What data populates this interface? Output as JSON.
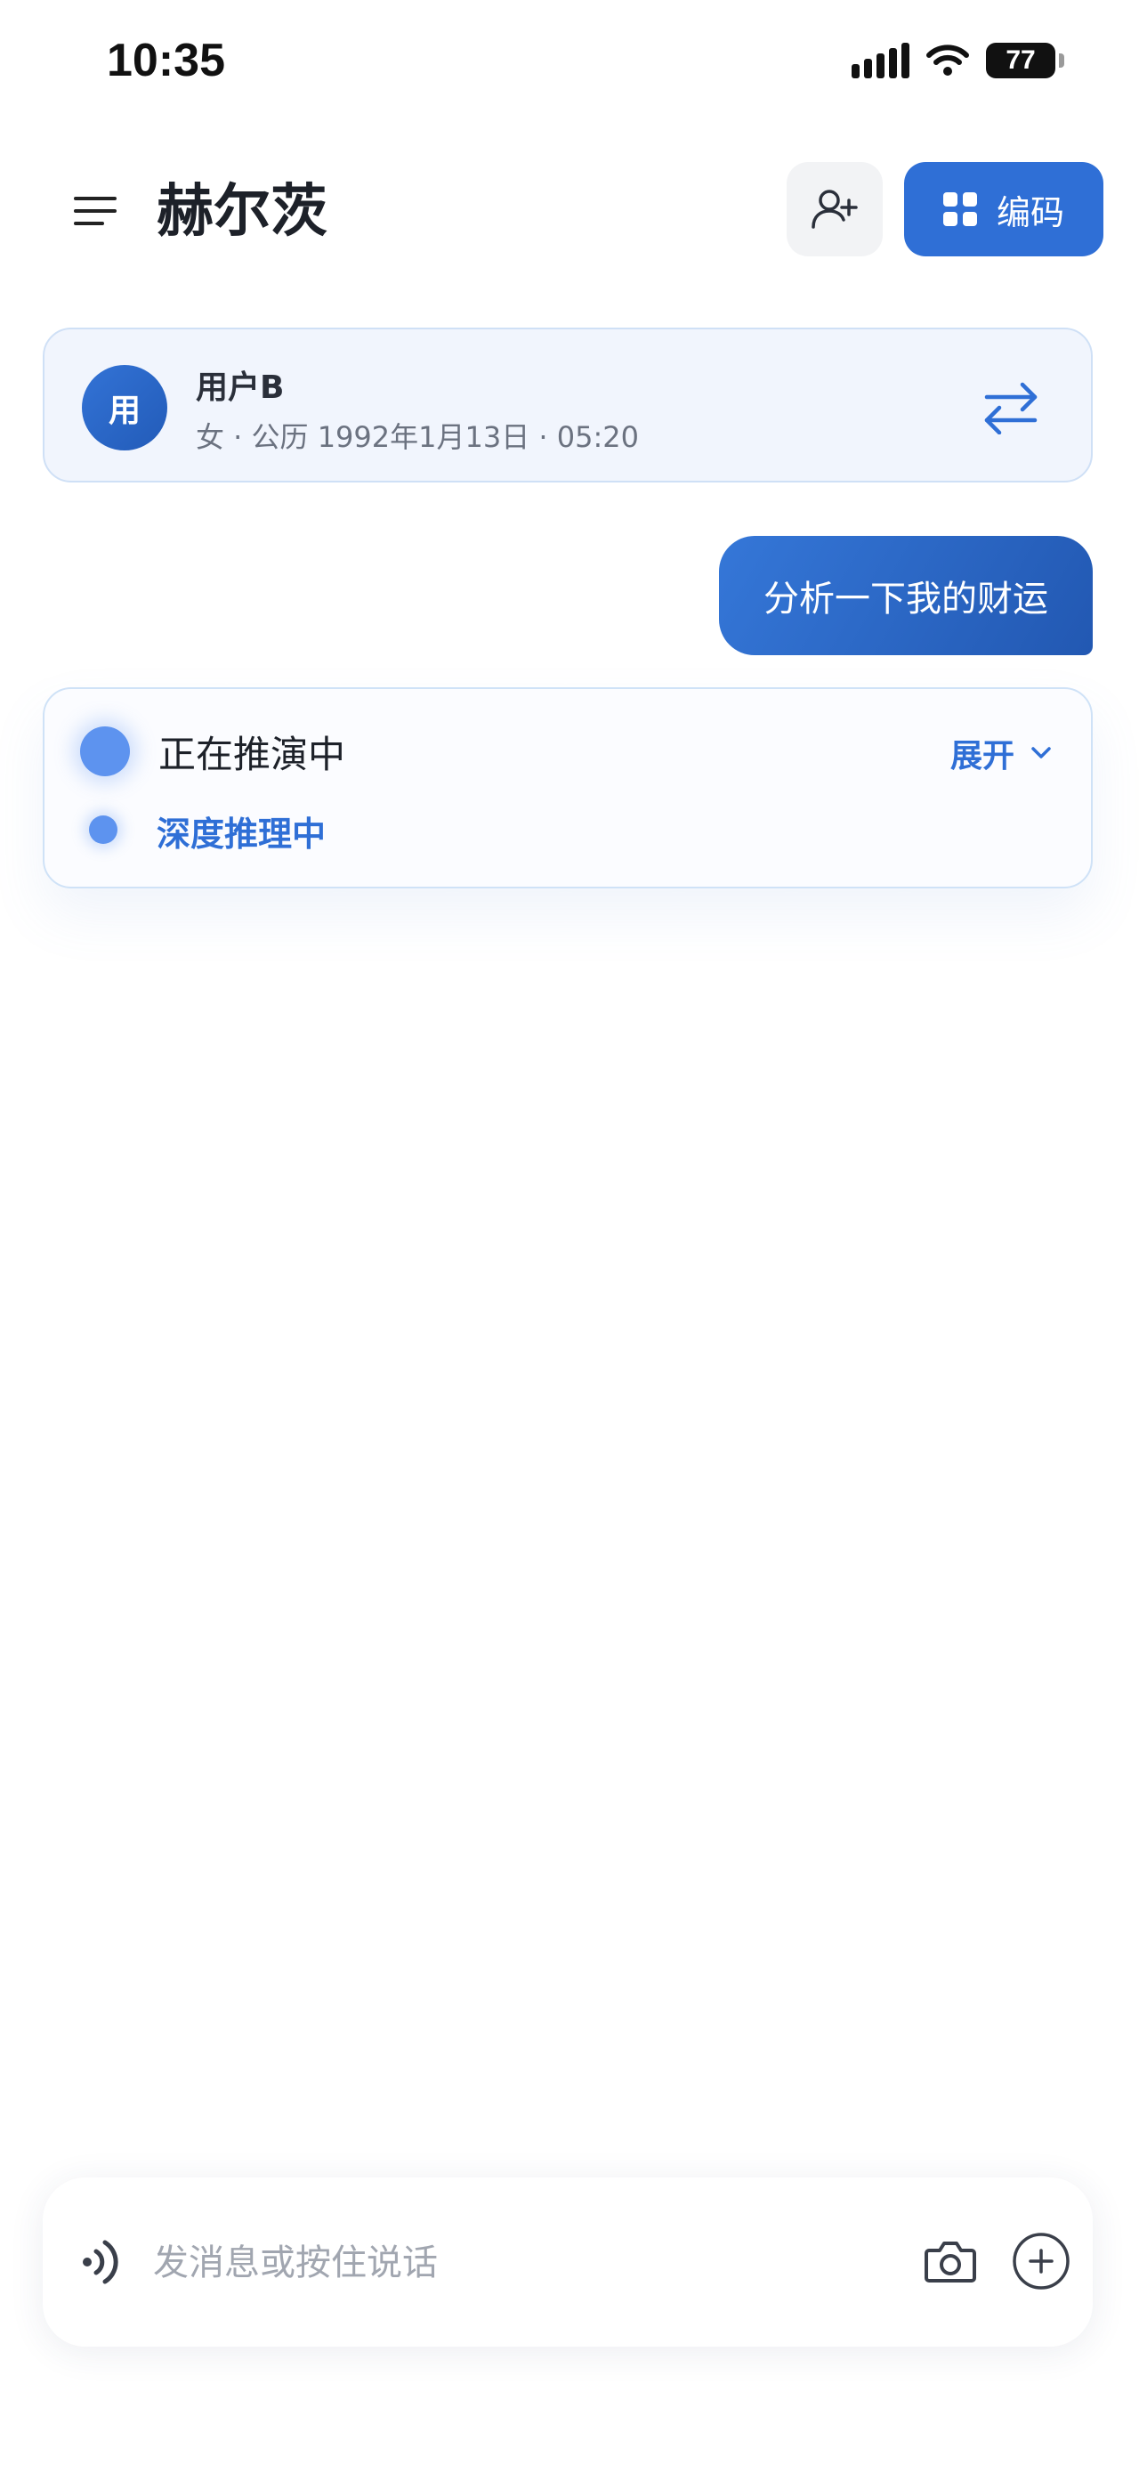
{
  "status_bar": {
    "time": "10:35",
    "battery": "77"
  },
  "header": {
    "title": "赫尔茨",
    "code_button_label": "编码"
  },
  "profile": {
    "avatar_text": "用",
    "name": "用户B",
    "meta": "女 · 公历 1992年1月13日 · 05:20"
  },
  "chat": {
    "user_message": "分析一下我的财运"
  },
  "reasoning": {
    "title": "正在推演中",
    "expand_label": "展开",
    "step_label": "深度推理中"
  },
  "composer": {
    "placeholder": "发消息或按住说话"
  },
  "colors": {
    "accent": "#2f6fd6",
    "card_bg": "#f1f5fd",
    "pulse": "#5d93ef"
  }
}
